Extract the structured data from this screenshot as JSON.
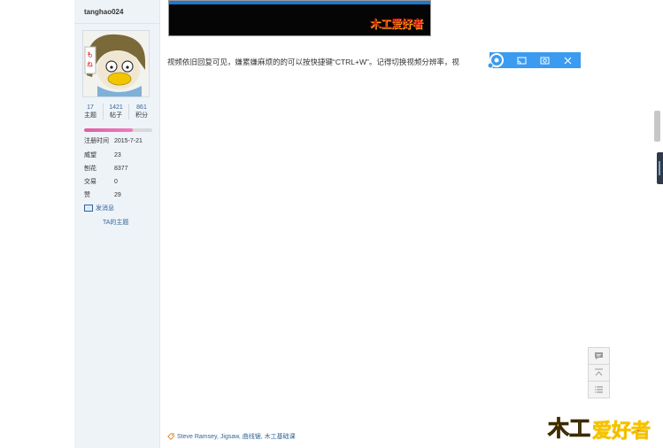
{
  "author": {
    "username": "tanghao024",
    "stats": [
      {
        "value": "17",
        "label": "主题"
      },
      {
        "value": "1421",
        "label": "帖子"
      },
      {
        "value": "861",
        "label": "积分"
      }
    ],
    "progress": 0.72,
    "info": [
      {
        "key": "注册时间",
        "value": "2015-7-21"
      },
      {
        "key": "威望",
        "value": "23"
      },
      {
        "key": "刨花",
        "value": "8377"
      },
      {
        "key": "交易",
        "value": "0"
      },
      {
        "key": "赞",
        "value": "29"
      }
    ],
    "send_message": "发消息",
    "ta_topics": "TA的主题"
  },
  "post": {
    "text": "视频依旧回复可见，嫌累嫌麻烦的的可以按快捷键“CTRL+W”。记得切换视频分辨率，视",
    "tags": "Steve Ramsey, Jigsaw, 曲线锯, 木工基础课"
  },
  "watermark": {
    "small": "木工爱好者",
    "big_a": "木工",
    "big_b": "爱好者"
  },
  "colors": {
    "link": "#336699",
    "toolbar": "#3a9bf0",
    "brand_red": "#d0101a",
    "brand_yellow": "#f5c300"
  },
  "icons": {
    "toolbar": [
      "gear-icon",
      "cast-icon",
      "screenshot-icon",
      "close-icon"
    ],
    "side": [
      "reply-icon",
      "back-to-top-icon",
      "list-icon"
    ]
  }
}
